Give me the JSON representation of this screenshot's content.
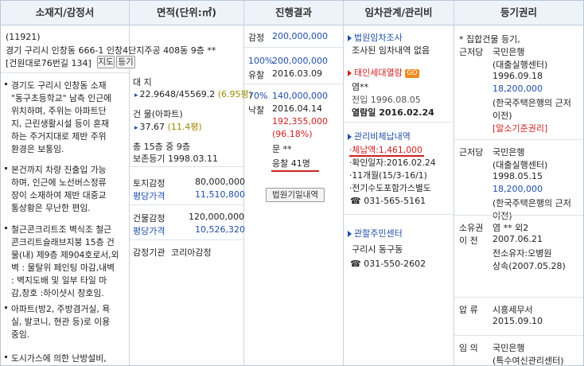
{
  "headers": {
    "location": "소재지/감정서",
    "area": "면적(단위:㎡)",
    "progress": "진행결과",
    "tenancy": "임차관계/관리비",
    "registry": "등기권리"
  },
  "location": {
    "case_no": "(11921)",
    "address": "경기 구리시 인창동 666-1 인창4단지주공 408동 9층 **",
    "building_name": "[건원대로76번길 134]",
    "map_btn": "지도",
    "reg_btn": "등기",
    "notes": [
      [
        "경기도 구리시 인창동 소재",
        "\"동구초등학교\" 남측 인근에",
        "위치하며, 주위는 아파트단",
        "지, 근린생활시설 등이 혼재",
        "하는 주거지대로 제반 주위",
        "환경은 보통임."
      ],
      [
        "본건까지 차량 진출입 가능",
        "하며, 인근에 노선버스정류",
        "장이 소재하여 제반 대중교",
        "통상황은 무난한 편임."
      ],
      [
        "철근콘크리트조 벽식조 철근",
        "콘크리트슬래브지붕 15층 건",
        "물(내) 제9층 제904호로서,외",
        "벽 : 물탈위 페인팅 마감,내벽",
        ": 벽지도배 및 일부 타일 마",
        "감,창호 :하이샷시 창호임."
      ],
      [
        "아파트(방2, 주방겸거실, 욕",
        "실, 발코니, 현관 등)로 이용",
        "중임."
      ],
      [
        "도시가스에 의한 난방설비,"
      ]
    ]
  },
  "area": {
    "land_label": "대 지",
    "land_value": "22.9648/45569.2",
    "land_pyeong": "(6.95평)",
    "bldg_label": "건 물(아파트)",
    "bldg_value": "37.67",
    "bldg_pyeong": "(11.4평)",
    "floors": "총 15층 중 9층",
    "preserve": "보존등기 1998.03.11",
    "land_appraisal_label": "토지감정",
    "land_appraisal_value": "80,000,000",
    "land_unit_label": "평당가격",
    "land_unit_value": "11,510,800",
    "bldg_appraisal_label": "건물감정",
    "bldg_appraisal_value": "120,000,000",
    "bldg_unit_label": "평당가격",
    "bldg_unit_value": "10,526,320",
    "agency_label": "감정기관",
    "agency_value": "코리아감정"
  },
  "progress": {
    "appraisal_label": "감정",
    "appraisal_value": "200,000,000",
    "r1_pct": "100%",
    "r1_value": "200,000,000",
    "r1_label": "유찰",
    "r1_date": "2016.03.09",
    "r2_pct": "70%",
    "r2_value": "140,000,000",
    "r2_label": "낙찰",
    "r2_date": "2016.04.14",
    "sale_price": "192,355,000",
    "sale_rate": "(96.18%)",
    "winner": "문 **",
    "bidders": "응찰 41명",
    "court_btn": "법원기일내역"
  },
  "tenancy": {
    "court_title": "법원임차조사",
    "court_text": "조사된 임차내역 없음",
    "resident_title": "태인세대열람",
    "go_badge": "GO",
    "resident_name": "염**",
    "resident_movein": "전입 1996.08.05",
    "resident_viewed": "열람일 2016.02.24",
    "mgmt_title": "관리비체납내역",
    "mgmt_items": [
      "·체납액:1,461,000",
      "·확인일자:2016.02.24",
      "·11개월(15/3-16/1)",
      "·전기수도포함가스별도"
    ],
    "mgmt_phone": "031-565-5161",
    "center_title": "관할주민센터",
    "center_name": "구리시 동구동",
    "center_phone": "031-550-2602"
  },
  "registry": {
    "title": "* 집합건물 등기,",
    "entries": [
      {
        "label": "근저당",
        "lines": [
          "국민은행",
          "(대출실행센터)",
          "1996.09.18",
          "18,200,000",
          "(한국주택은행의 근저",
          "이전)",
          "[말소기준권리]"
        ]
      },
      {
        "label": "근저당",
        "lines": [
          "국민은행",
          "(대출실행센터)",
          "1998.05.15",
          "18,200,000",
          "(한국주택은행의 근저",
          "이전)"
        ]
      },
      {
        "label": "소유권\n이    전",
        "lines": [
          "염 ** 외2",
          "2007.06.21",
          "전소유자:오병원",
          "상속(2007.05.28)"
        ]
      },
      {
        "label": "압    류",
        "lines": [
          "시흥세무서",
          "2015.09.10"
        ]
      },
      {
        "label": "임    의",
        "lines": [
          "국민은행",
          "(특수여신관리센터)"
        ]
      }
    ]
  }
}
